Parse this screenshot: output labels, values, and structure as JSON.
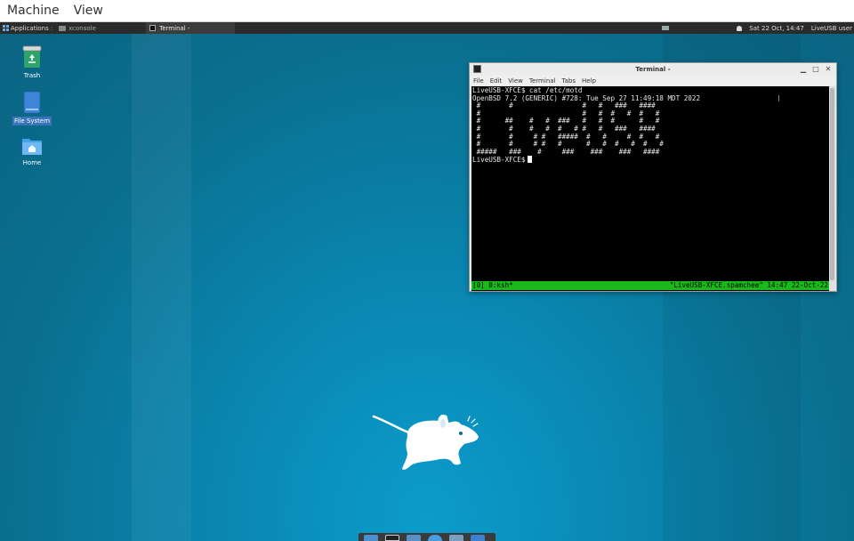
{
  "host_menu": {
    "machine": "Machine",
    "view": "View"
  },
  "panel": {
    "applications": "Applications",
    "separator": ":",
    "tasks": [
      {
        "label": "xconsole",
        "active": false
      },
      {
        "label": "Terminal -",
        "active": true
      }
    ],
    "clock": "Sat 22 Oct, 14:47",
    "user": "LiveUSB user"
  },
  "desktop_icons": [
    {
      "label": "Trash",
      "icon": "trash-icon"
    },
    {
      "label": "File System",
      "icon": "drive-icon",
      "selected": true
    },
    {
      "label": "Home",
      "icon": "home-folder-icon"
    }
  ],
  "terminal": {
    "title": "Terminal -",
    "menu": [
      "File",
      "Edit",
      "View",
      "Terminal",
      "Tabs",
      "Help"
    ],
    "lines": [
      "LiveUSB-XFCE$ cat /etc/motd",
      "OpenBSD 7.2 (GENERIC) #728: Tue Sep 27 11:49:18 MDT 2022",
      "",
      "",
      "",
      " #       #                 #   #   ###   ####",
      " #                         #   #  #   #  #   #",
      " #      ##    #   #  ###   #   #  #      #   #",
      " #       #    #   #  #   # #   #   ###   ####",
      " #       #     # #   #####  #   #     #  #   #",
      " #       #     # #   #      #   #  #   #  #   #",
      " #####   ###    #     ###    ###    ###   ####",
      "",
      "",
      "",
      "",
      ""
    ],
    "prompt": "LiveUSB-XFCE$",
    "status_left": "[0] 0:ksh*",
    "status_right": "\"LiveUSB-XFCE.spamchee\" 14:47 22-Oct-22"
  },
  "colors": {
    "desktop": "#0a6f8f",
    "terminal_bg": "#000000",
    "tmux_status": "#1bb81b",
    "selection": "#3a74b9"
  }
}
